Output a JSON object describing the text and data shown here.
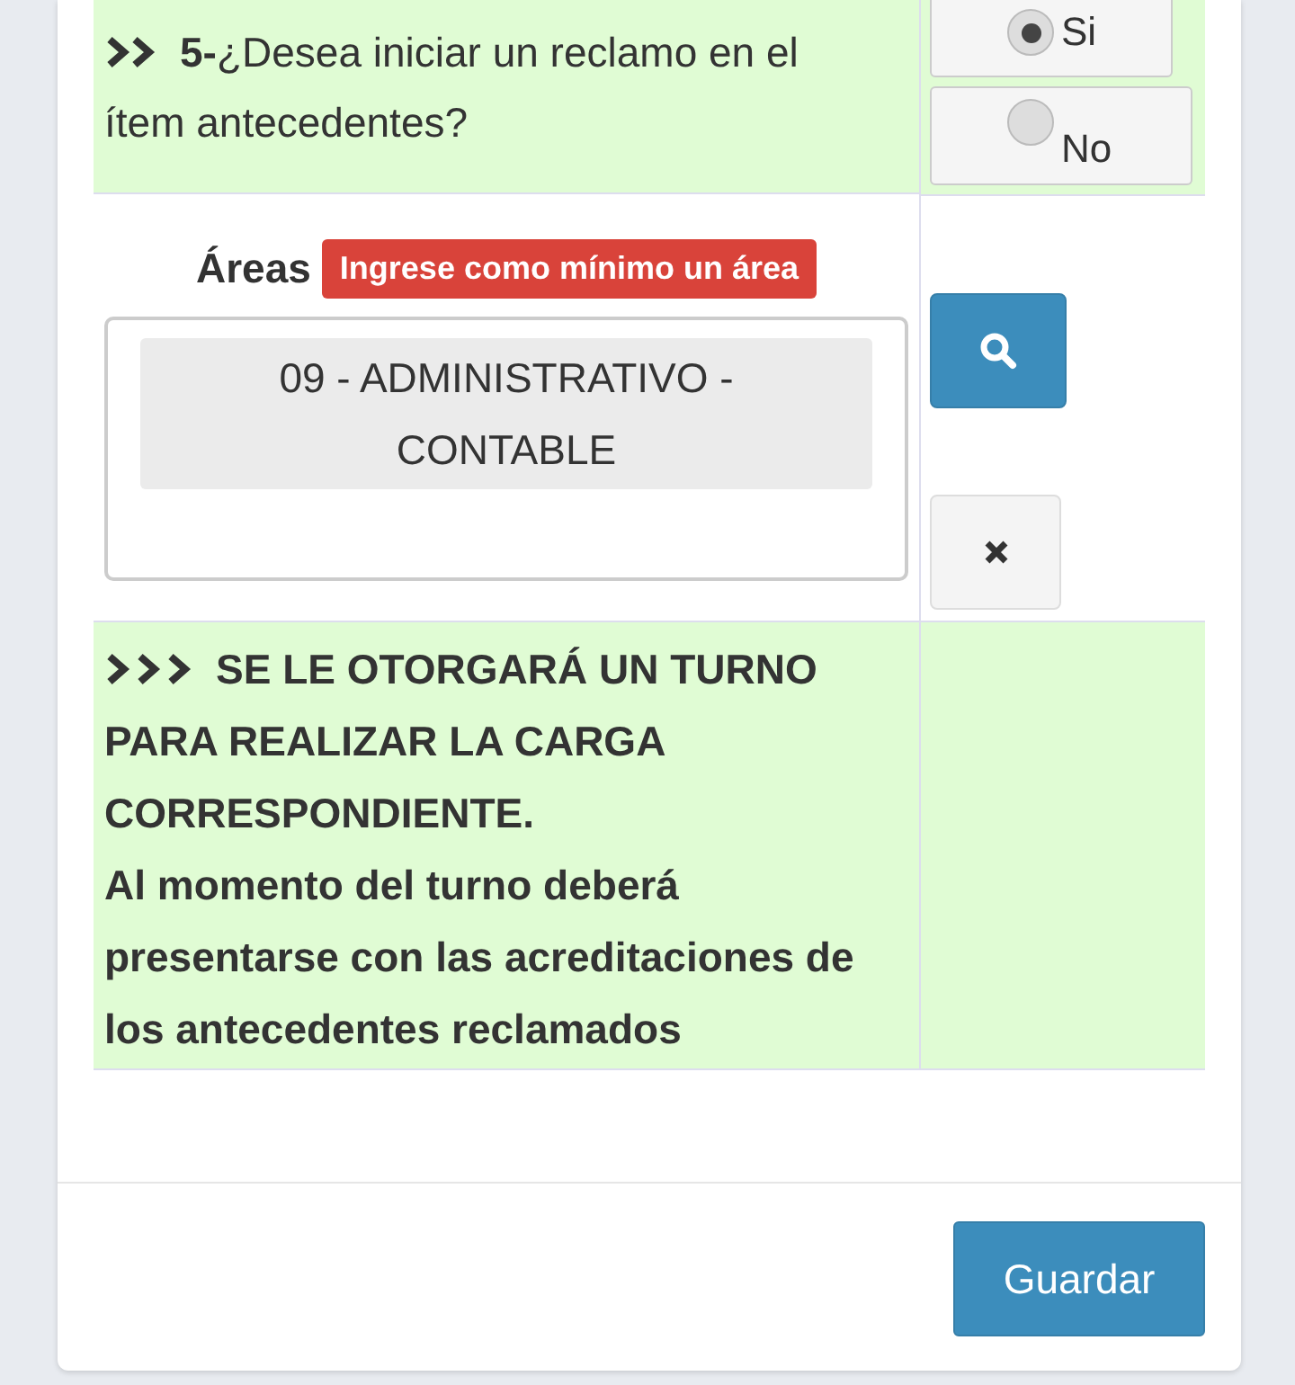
{
  "question": {
    "number": "5-",
    "text": "¿Desea iniciar un reclamo en el ítem antecedentes?",
    "options": [
      {
        "label": "Si",
        "selected": true
      },
      {
        "label": "No",
        "selected": false
      }
    ]
  },
  "areas": {
    "label": "Áreas",
    "error": "Ingrese como mínimo un área",
    "items": [
      "09 - ADMINISTRATIVO - CONTABLE"
    ]
  },
  "notice": {
    "heading": "SE LE OTORGARÁ UN TURNO PARA REALIZAR LA CARGA CORRESPONDIENTE.",
    "text": "Al momento del turno deberá presentarse con las acreditaciones de los antecedentes reclamados"
  },
  "save_button": "Guardar"
}
